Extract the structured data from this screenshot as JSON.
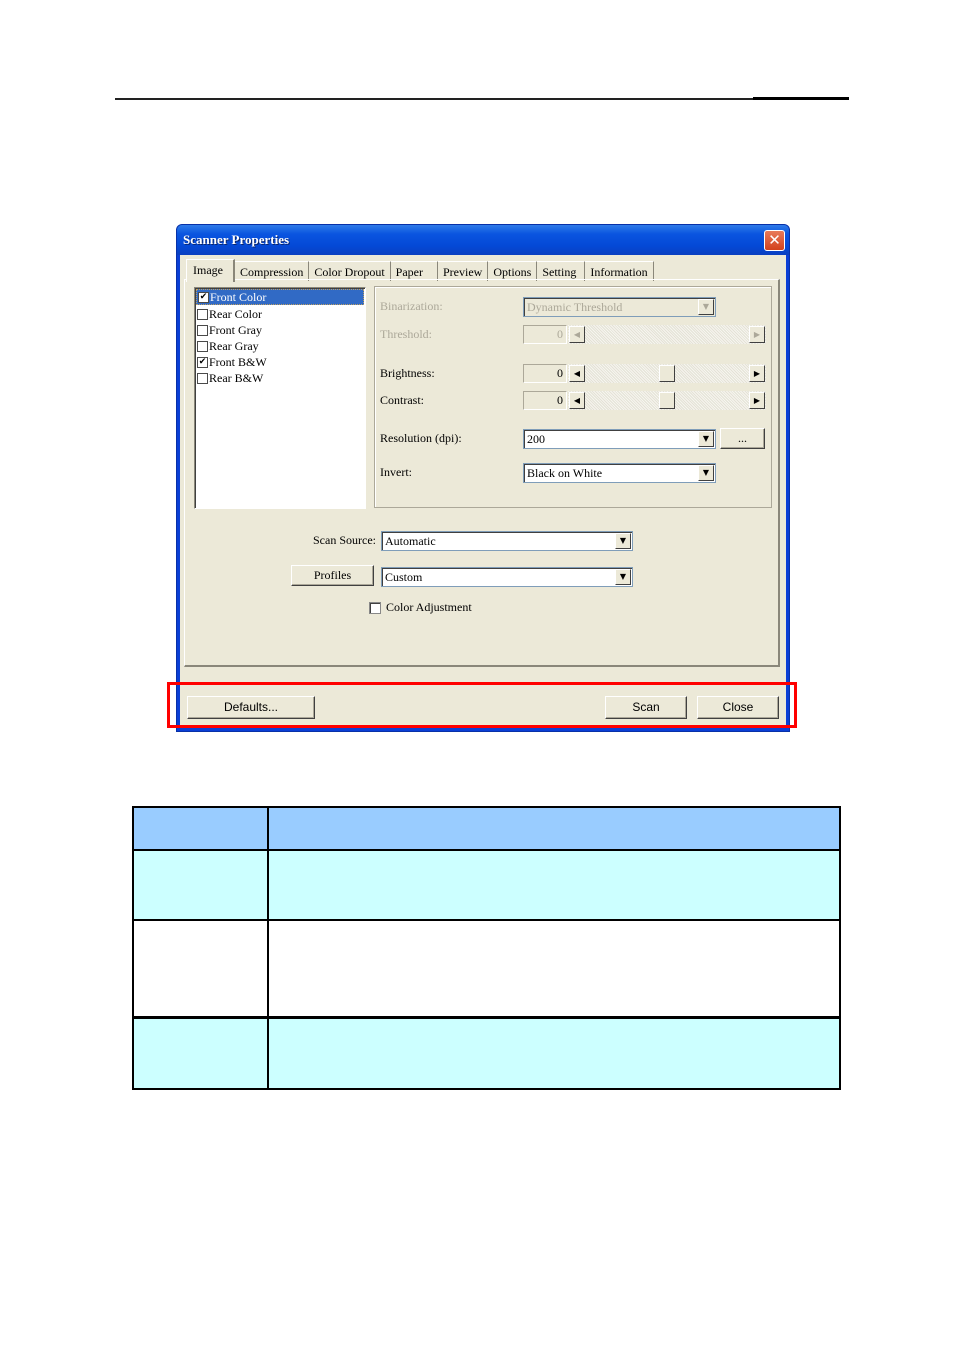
{
  "dialog": {
    "title": "Scanner Properties",
    "close_icon": "close-x-icon",
    "tabs": [
      "Image",
      "Compression",
      "Color Dropout",
      "Paper",
      "Preview",
      "Options",
      "Setting",
      "Information"
    ],
    "active_tab": "Image",
    "image_list": [
      {
        "label": "Front Color",
        "checked": true,
        "selected": true
      },
      {
        "label": "Rear Color",
        "checked": false,
        "selected": false
      },
      {
        "label": "Front Gray",
        "checked": false,
        "selected": false
      },
      {
        "label": "Rear Gray",
        "checked": false,
        "selected": false
      },
      {
        "label": "Front B&W",
        "checked": true,
        "selected": false
      },
      {
        "label": "Rear B&W",
        "checked": false,
        "selected": false
      }
    ],
    "settings": {
      "binarization": {
        "label": "Binarization:",
        "value": "Dynamic Threshold",
        "enabled": false
      },
      "threshold": {
        "label": "Threshold:",
        "value": "0",
        "enabled": false
      },
      "brightness": {
        "label": "Brightness:",
        "value": "0",
        "slider_fraction": 0.5
      },
      "contrast": {
        "label": "Contrast:",
        "value": "0",
        "slider_fraction": 0.5
      },
      "resolution": {
        "label": "Resolution (dpi):",
        "value": "200",
        "more_button": "..."
      },
      "invert": {
        "label": "Invert:",
        "value": "Black on White"
      }
    },
    "scan_source": {
      "label": "Scan Source:",
      "value": "Automatic"
    },
    "profiles": {
      "button": "Profiles",
      "value": "Custom"
    },
    "color_adjustment": {
      "label": "Color Adjustment",
      "checked": false
    },
    "footer": {
      "defaults": "Defaults...",
      "scan": "Scan",
      "close": "Close"
    }
  },
  "annotation": {
    "highlight_color": "#ff0000"
  },
  "table": {
    "colors": {
      "header": "#99ccff",
      "alt_row": "#ccffff"
    },
    "header": [
      "",
      ""
    ],
    "rows": [
      [
        "",
        ""
      ],
      [
        "",
        ""
      ],
      [
        "",
        ""
      ]
    ]
  }
}
